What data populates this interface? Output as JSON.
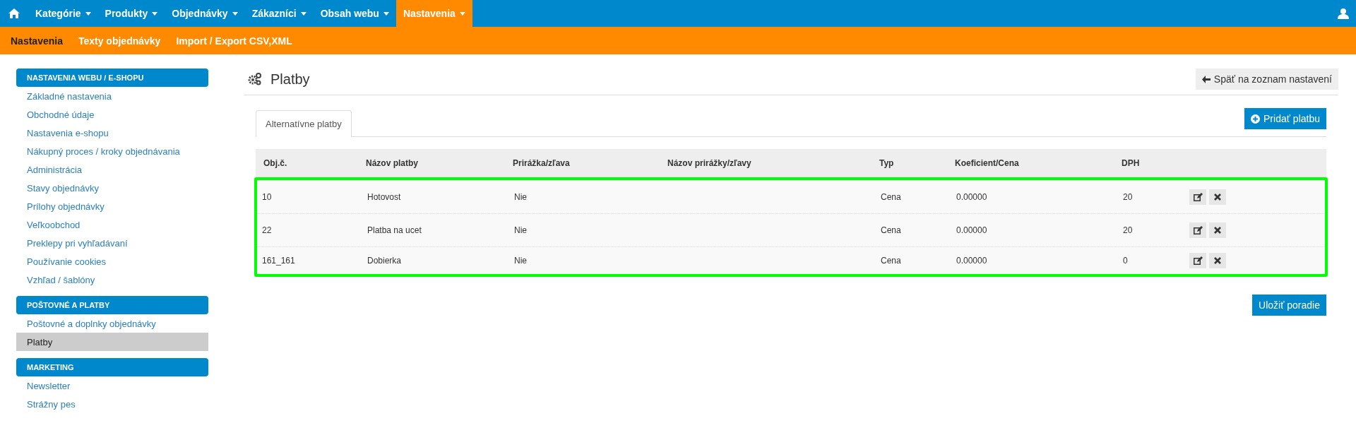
{
  "topnav": {
    "items": [
      {
        "label": "Kategórie",
        "selected": false
      },
      {
        "label": "Produkty",
        "selected": false
      },
      {
        "label": "Objednávky",
        "selected": false
      },
      {
        "label": "Zákazníci",
        "selected": false
      },
      {
        "label": "Obsah webu",
        "selected": false
      },
      {
        "label": "Nastavenia",
        "selected": true
      }
    ]
  },
  "subnav": {
    "items": [
      {
        "label": "Nastavenia",
        "selected": true
      },
      {
        "label": "Texty objednávky",
        "selected": false
      },
      {
        "label": "Import / Export CSV,XML",
        "selected": false
      }
    ]
  },
  "sidebar": {
    "sections": [
      {
        "title": "NASTAVENIA WEBU / E-SHOPU",
        "items": [
          {
            "label": "Základné nastavenia",
            "selected": false
          },
          {
            "label": "Obchodné údaje",
            "selected": false
          },
          {
            "label": "Nastavenia e-shopu",
            "selected": false
          },
          {
            "label": "Nákupný proces / kroky objednávania",
            "selected": false
          },
          {
            "label": "Administrácia",
            "selected": false
          },
          {
            "label": "Stavy objednávky",
            "selected": false
          },
          {
            "label": "Prílohy objednávky",
            "selected": false
          },
          {
            "label": "Veľkoobchod",
            "selected": false
          },
          {
            "label": "Preklepy pri vyhľadávaní",
            "selected": false
          },
          {
            "label": "Používanie cookies",
            "selected": false
          },
          {
            "label": "Vzhľad / šablóny",
            "selected": false
          }
        ]
      },
      {
        "title": "POŠTOVNÉ A PLATBY",
        "items": [
          {
            "label": "Poštovné a doplnky objednávky",
            "selected": false
          },
          {
            "label": "Platby",
            "selected": true
          }
        ]
      },
      {
        "title": "MARKETING",
        "items": [
          {
            "label": "Newsletter",
            "selected": false
          },
          {
            "label": "Strážny pes",
            "selected": false
          }
        ]
      }
    ]
  },
  "page": {
    "title": "Platby",
    "back_button": "Späť na zoznam nastavení"
  },
  "tabs": [
    {
      "label": "Alternatívne platby",
      "selected": true
    }
  ],
  "add_button": "Pridať platbu",
  "table": {
    "columns": [
      "Obj.č.",
      "Názov platby",
      "Prirážka/zľava",
      "Názov prirážky/zľavy",
      "Typ",
      "Koeficient/Cena",
      "DPH"
    ],
    "rows": [
      {
        "cells": [
          "10",
          "Hotovost",
          "Nie",
          "",
          "Cena",
          "0.00000",
          "20"
        ]
      },
      {
        "cells": [
          "22",
          "Platba na ucet",
          "Nie",
          "",
          "Cena",
          "0.00000",
          "20"
        ]
      },
      {
        "cells": [
          "161_161",
          "Dobierka",
          "Nie",
          "",
          "Cena",
          "0.00000",
          "0"
        ]
      }
    ]
  },
  "save_button": "Uložiť poradie"
}
